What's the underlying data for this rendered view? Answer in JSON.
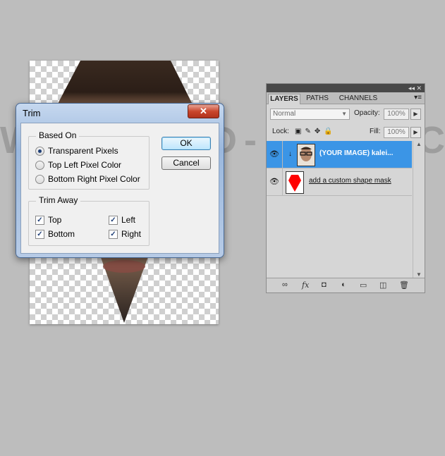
{
  "watermark": "WWW.PSD-DUDE.COM",
  "trim_dialog": {
    "title": "Trim",
    "close_glyph": "✕",
    "based_on": {
      "legend": "Based On",
      "options": [
        {
          "label": "Transparent Pixels",
          "selected": true
        },
        {
          "label": "Top Left Pixel Color",
          "selected": false
        },
        {
          "label": "Bottom Right Pixel Color",
          "selected": false
        }
      ]
    },
    "trim_away": {
      "legend": "Trim Away",
      "top": "Top",
      "bottom": "Bottom",
      "left": "Left",
      "right": "Right"
    },
    "ok_label": "OK",
    "cancel_label": "Cancel"
  },
  "layers_panel": {
    "tabs": [
      "LAYERS",
      "PATHS",
      "CHANNELS"
    ],
    "blend_mode": "Normal",
    "opacity_label": "Opacity:",
    "opacity_value": "100%",
    "lock_label": "Lock:",
    "fill_label": "Fill:",
    "fill_value": "100%",
    "layers": [
      {
        "name": "(YOUR IMAGE) kalei...",
        "selected": true
      },
      {
        "name": "add a custom shape mask",
        "selected": false
      }
    ],
    "accent_color": "#3b95e6"
  }
}
